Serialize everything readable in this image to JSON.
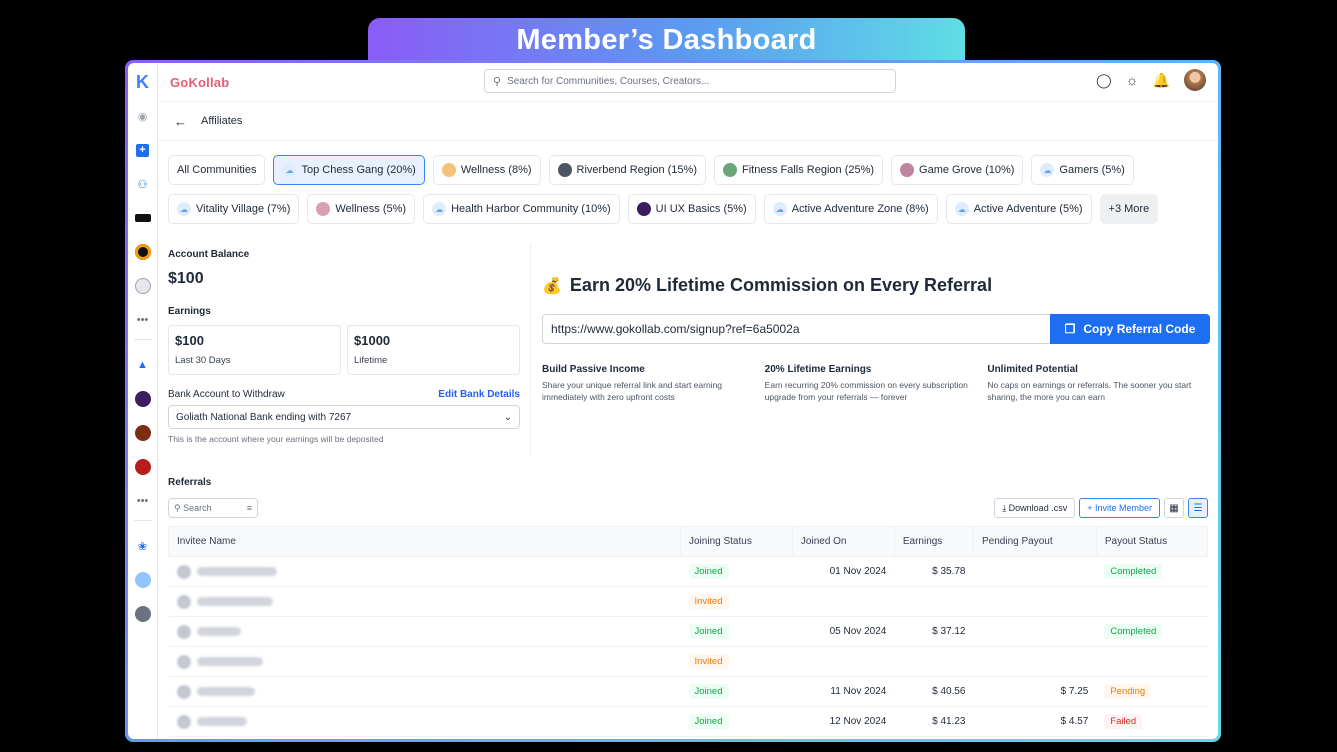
{
  "banner": {
    "title": "Member’s Dashboard"
  },
  "app": {
    "brand_a": "Go",
    "brand_b": "Kollab"
  },
  "search": {
    "placeholder": "Search for Communities, Courses, Creators..."
  },
  "page": {
    "title": "Affiliates"
  },
  "chips": {
    "row1": [
      "All Communities",
      "Top Chess Gang (20%)",
      "Wellness (8%)",
      "Riverbend Region (15%)",
      "Fitness Falls Region (25%)",
      "Game Grove (10%)",
      "Gamers (5%)"
    ],
    "row2": [
      "Vitality Village (7%)",
      "Wellness (5%)",
      "Health Harbor Community (10%)",
      "UI UX Basics (5%)",
      "Active Adventure Zone (8%)",
      "Active Adventure (5%)",
      "+3 More"
    ]
  },
  "account": {
    "balance_label": "Account Balance",
    "balance": "$100",
    "earnings_label": "Earnings",
    "e1_value": "$100",
    "e1_label": "Last 30 Days",
    "e2_value": "$1000",
    "e2_label": "Lifetime",
    "bank_label": "Bank Account to Withdraw",
    "edit_label": "Edit Bank Details",
    "bank_value": "Goliath National Bank ending with 7267",
    "bank_hint": "This is the account where your earnings will be deposited"
  },
  "referral": {
    "icon": "💰",
    "title": "Earn 20% Lifetime Commission on Every Referral",
    "link": "https://www.gokollab.com/signup?ref=6a5002a",
    "copy_label": "Copy Referral Code",
    "features": [
      {
        "title": "Build Passive Income",
        "desc": "Share your unique referral link and start earning immediately with zero upfront costs"
      },
      {
        "title": "20% Lifetime Earnings",
        "desc": "Earn recurring 20% commission on every subscription upgrade from your referrals — forever"
      },
      {
        "title": "Unlimited Potential",
        "desc": "No caps on earnings or referrals. The sooner you start sharing, the more you can earn"
      }
    ]
  },
  "referrals": {
    "title": "Referrals",
    "search_placeholder": "Search",
    "download_label": "Download .csv",
    "invite_label": "Invite Member",
    "columns": [
      "Invitee Name",
      "Joining Status",
      "Joined On",
      "Earnings",
      "Pending Payout",
      "Payout Status"
    ],
    "rows": [
      {
        "status": "Joined",
        "joined_on": "01 Nov 2024",
        "earnings": "$ 35.78",
        "pending": "",
        "payout": "Completed"
      },
      {
        "status": "Invited",
        "joined_on": "",
        "earnings": "",
        "pending": "",
        "payout": ""
      },
      {
        "status": "Joined",
        "joined_on": "05 Nov 2024",
        "earnings": "$ 37.12",
        "pending": "",
        "payout": "Completed"
      },
      {
        "status": "Invited",
        "joined_on": "",
        "earnings": "",
        "pending": "",
        "payout": ""
      },
      {
        "status": "Joined",
        "joined_on": "11 Nov 2024",
        "earnings": "$ 40.56",
        "pending": "$ 7.25",
        "payout": "Pending"
      },
      {
        "status": "Joined",
        "joined_on": "12 Nov 2024",
        "earnings": "$ 41.23",
        "pending": "$ 4.57",
        "payout": "Failed"
      }
    ]
  }
}
